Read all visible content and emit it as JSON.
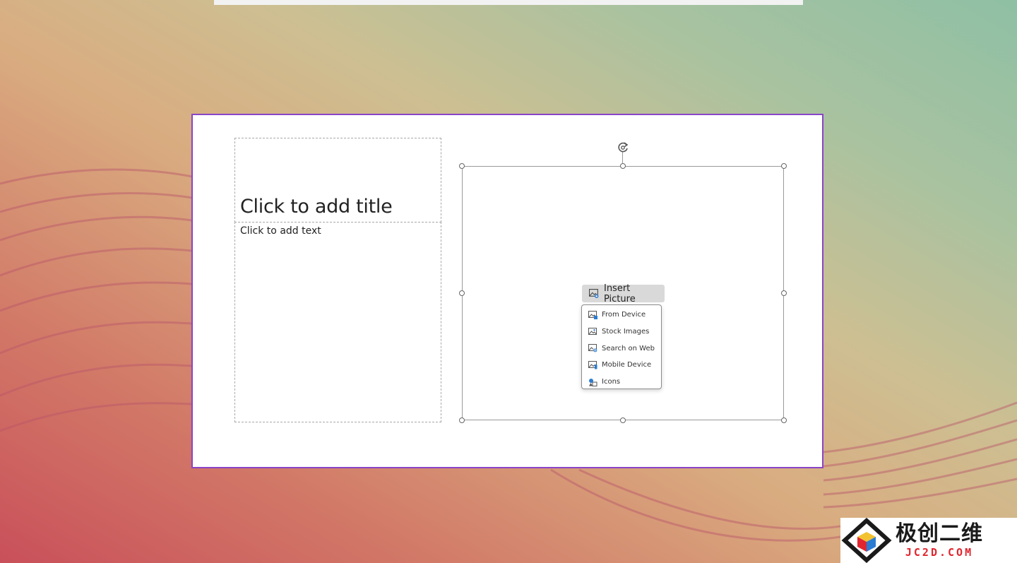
{
  "slide": {
    "title_placeholder": "Click to add title",
    "body_placeholder": "Click to add text"
  },
  "insert_picture": {
    "button_label": "Insert Picture",
    "menu_items": [
      {
        "label": "From Device",
        "icon": "from-device-icon"
      },
      {
        "label": "Stock Images",
        "icon": "stock-images-icon"
      },
      {
        "label": "Search on Web",
        "icon": "search-on-web-icon"
      },
      {
        "label": "Mobile Device",
        "icon": "mobile-device-icon"
      },
      {
        "label": "Icons",
        "icon": "icons-icon"
      }
    ]
  },
  "watermark": {
    "chinese": "极创二维",
    "domain": "JC2D.COM"
  },
  "colors": {
    "slide_border": "#8a44c8",
    "watermark_red": "#e0262f",
    "icon_blue": "#2b7cd3"
  }
}
